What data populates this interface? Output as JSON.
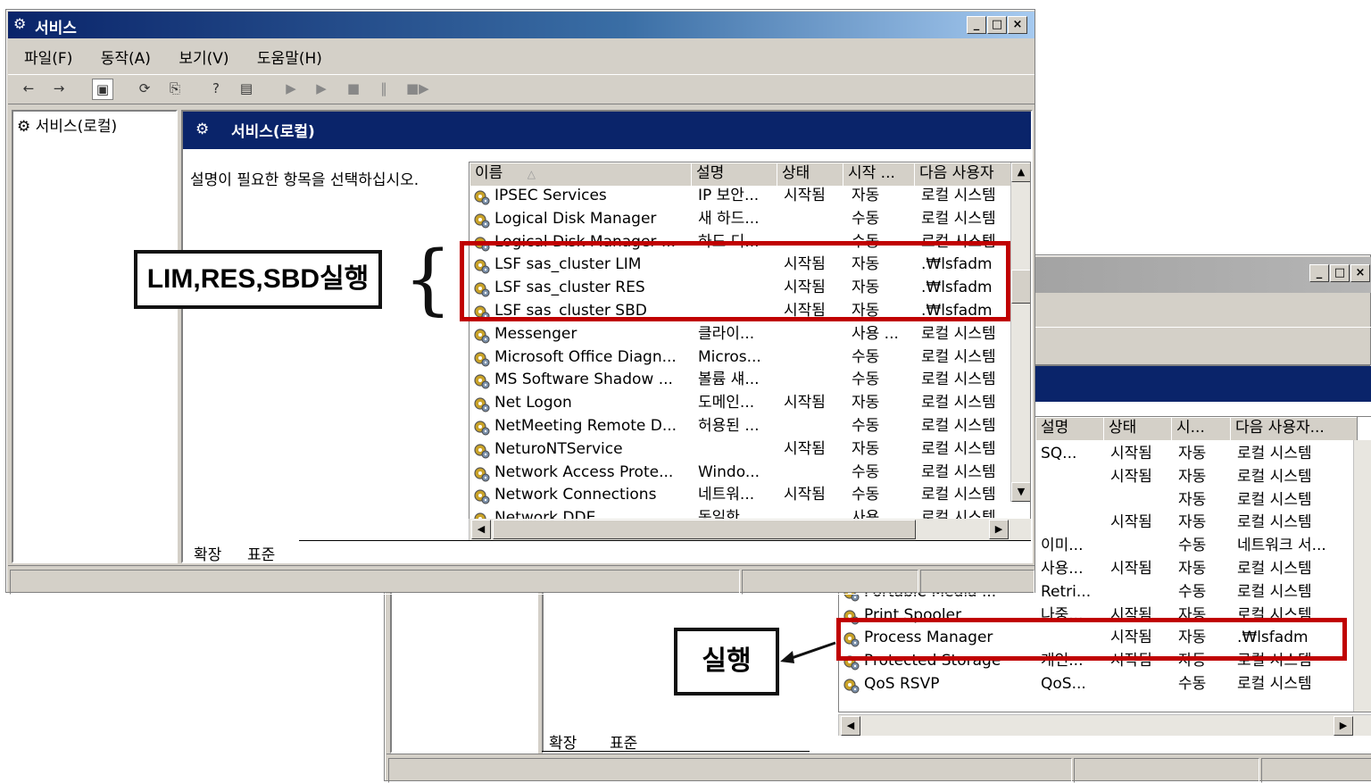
{
  "back_window": {
    "list_headers": [
      "설명",
      "상태",
      "시...",
      "다음 사용자..."
    ],
    "rows": [
      {
        "name": "",
        "desc": "SQ...",
        "status": "시작됨",
        "startup": "자동",
        "user": "로컬 시스템"
      },
      {
        "name": "",
        "desc": "",
        "status": "시작됨",
        "startup": "자동",
        "user": "로컬 시스템"
      },
      {
        "name": "",
        "desc": "",
        "status": "",
        "startup": "자동",
        "user": "로컬 시스템"
      },
      {
        "name": "",
        "desc": "",
        "status": "시작됨",
        "startup": "자동",
        "user": "로컬 시스템"
      },
      {
        "name": "",
        "desc": "이미...",
        "status": "",
        "startup": "수동",
        "user": "네트워크 서..."
      },
      {
        "name": "",
        "desc": "사용...",
        "status": "시작됨",
        "startup": "자동",
        "user": "로컬 시스템"
      },
      {
        "name": "Portable Media ...",
        "desc": "Retri...",
        "status": "",
        "startup": "수동",
        "user": "로컬 시스템"
      },
      {
        "name": "Print Spooler",
        "desc": "나중...",
        "status": "시작됨",
        "startup": "자동",
        "user": "로컬 시스템"
      },
      {
        "name": "Process Manager",
        "desc": "",
        "status": "시작됨",
        "startup": "자동",
        "user": ".₩lsfadm"
      },
      {
        "name": "Protected Storage",
        "desc": "개인...",
        "status": "시작됨",
        "startup": "자동",
        "user": "로컬 시스템"
      },
      {
        "name": "QoS RSVP",
        "desc": "QoS...",
        "status": "",
        "startup": "수동",
        "user": "로컬 시스템"
      }
    ],
    "tabs": [
      "확장",
      "표준"
    ]
  },
  "front_window": {
    "title": "서비스",
    "menu": [
      "파일(F)",
      "동작(A)",
      "보기(V)",
      "도움말(H)"
    ],
    "tree_item": "서비스(로컬)",
    "pane_title": "서비스(로컬)",
    "prompt": "설명이 필요한 항목을 선택하십시오.",
    "list_headers": [
      "이름",
      "설명",
      "상태",
      "시작 ...",
      "다음 사용자"
    ],
    "rows": [
      {
        "name": "IPSEC Services",
        "desc": "IP 보안...",
        "status": "시작됨",
        "startup": "자동",
        "user": "로컬 시스템"
      },
      {
        "name": "Logical Disk Manager",
        "desc": "새 하드...",
        "status": "",
        "startup": "수동",
        "user": "로컬 시스템"
      },
      {
        "name": "Logical Disk Manager ...",
        "desc": "하드 디...",
        "status": "",
        "startup": "수동",
        "user": "로컬 시스템"
      },
      {
        "name": "LSF sas_cluster LIM",
        "desc": "",
        "status": "시작됨",
        "startup": "자동",
        "user": ".₩lsfadm"
      },
      {
        "name": "LSF sas_cluster RES",
        "desc": "",
        "status": "시작됨",
        "startup": "자동",
        "user": ".₩lsfadm"
      },
      {
        "name": "LSF sas_cluster SBD",
        "desc": "",
        "status": "시작됨",
        "startup": "자동",
        "user": ".₩lsfadm"
      },
      {
        "name": "Messenger",
        "desc": "클라이...",
        "status": "",
        "startup": "사용 ...",
        "user": "로컬 시스템"
      },
      {
        "name": "Microsoft Office Diagn...",
        "desc": "Micros...",
        "status": "",
        "startup": "수동",
        "user": "로컬 시스템"
      },
      {
        "name": "MS Software Shadow ...",
        "desc": "볼륨 섀...",
        "status": "",
        "startup": "수동",
        "user": "로컬 시스템"
      },
      {
        "name": "Net Logon",
        "desc": "도메인...",
        "status": "시작됨",
        "startup": "자동",
        "user": "로컬 시스템"
      },
      {
        "name": "NetMeeting Remote D...",
        "desc": "허용된 ...",
        "status": "",
        "startup": "수동",
        "user": "로컬 시스템"
      },
      {
        "name": "NeturoNTService",
        "desc": "",
        "status": "시작됨",
        "startup": "자동",
        "user": "로컬 시스템"
      },
      {
        "name": "Network Access Prote...",
        "desc": "Windo...",
        "status": "",
        "startup": "수동",
        "user": "로컬 시스템"
      },
      {
        "name": "Network Connections",
        "desc": "네트워...",
        "status": "시작됨",
        "startup": "수동",
        "user": "로컬 시스템"
      },
      {
        "name": "Network DDE",
        "desc": "동일한 ...",
        "status": "",
        "startup": "사용 ...",
        "user": "로컬 시스템"
      }
    ],
    "tabs": [
      "확장",
      "표준"
    ]
  },
  "annotations": {
    "lim_res_sbd": "LIM,RES,SBD실행",
    "brace": "{",
    "run": "실행"
  },
  "colors": {
    "highlight_red": "#c00000",
    "title_blue": "#0a246a",
    "window_gray": "#d4d0c8"
  }
}
